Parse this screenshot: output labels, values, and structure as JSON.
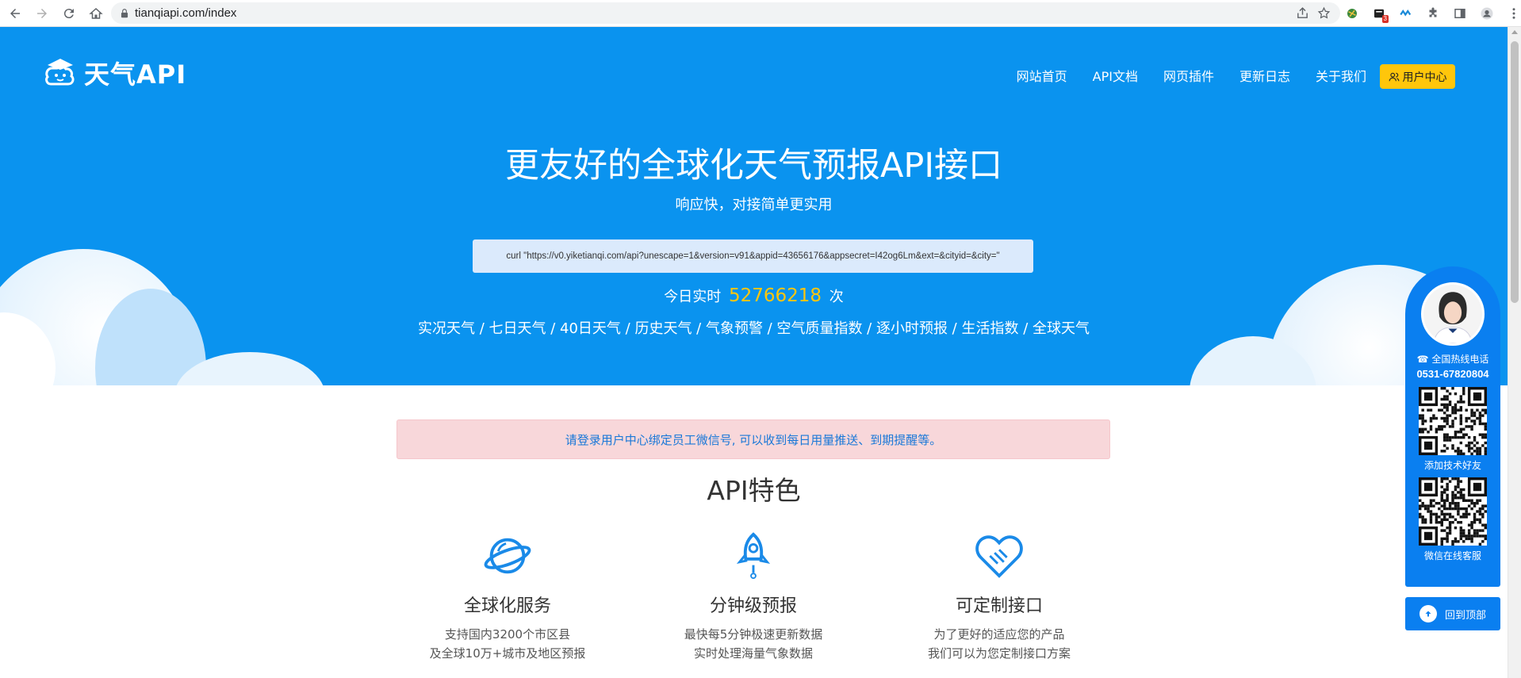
{
  "browser": {
    "url": "tianqiapi.com/index",
    "extension_badge": "3"
  },
  "header": {
    "logo_text": "天气API",
    "nav": [
      "网站首页",
      "API文档",
      "网页插件",
      "更新日志",
      "关于我们"
    ],
    "user_center": "用户中心"
  },
  "hero": {
    "title": "更友好的全球化天气预报API接口",
    "subtitle": "响应快，对接简单更实用",
    "curl_example": "curl \"https://v0.yiketianqi.com/api?unescape=1&version=v91&appid=43656176&appsecret=I42og6Lm&ext=&cityid=&city=\"",
    "counter_prefix": "今日实时",
    "counter_value": "52766218",
    "counter_suffix": "次",
    "features_line": "实况天气 / 七日天气 / 40日天气 / 历史天气 / 气象预警 / 空气质量指数 / 逐小时预报 / 生活指数 / 全球天气"
  },
  "alert": {
    "text": "请登录用户中心绑定员工微信号, 可以收到每日用量推送、到期提醒等。"
  },
  "features": {
    "title": "API特色",
    "items": [
      {
        "title": "全球化服务",
        "line1": "支持国内3200个市区县",
        "line2": "及全球10万+城市及地区预报"
      },
      {
        "title": "分钟级预报",
        "line1": "最快每5分钟极速更新数据",
        "line2": "实时处理海量气象数据"
      },
      {
        "title": "可定制接口",
        "line1": "为了更好的适应您的产品",
        "line2": "我们可以为您定制接口方案"
      }
    ]
  },
  "side": {
    "hotline_label": "全国热线电话",
    "hotline_number": "0531-67820804",
    "qr1_label": "添加技术好友",
    "qr2_label": "微信在线客服",
    "back_to_top": "回到顶部"
  },
  "colors": {
    "hero_blue": "#0a93ef",
    "accent_yellow": "#ffc60b",
    "panel_blue": "#0a7ff0"
  }
}
